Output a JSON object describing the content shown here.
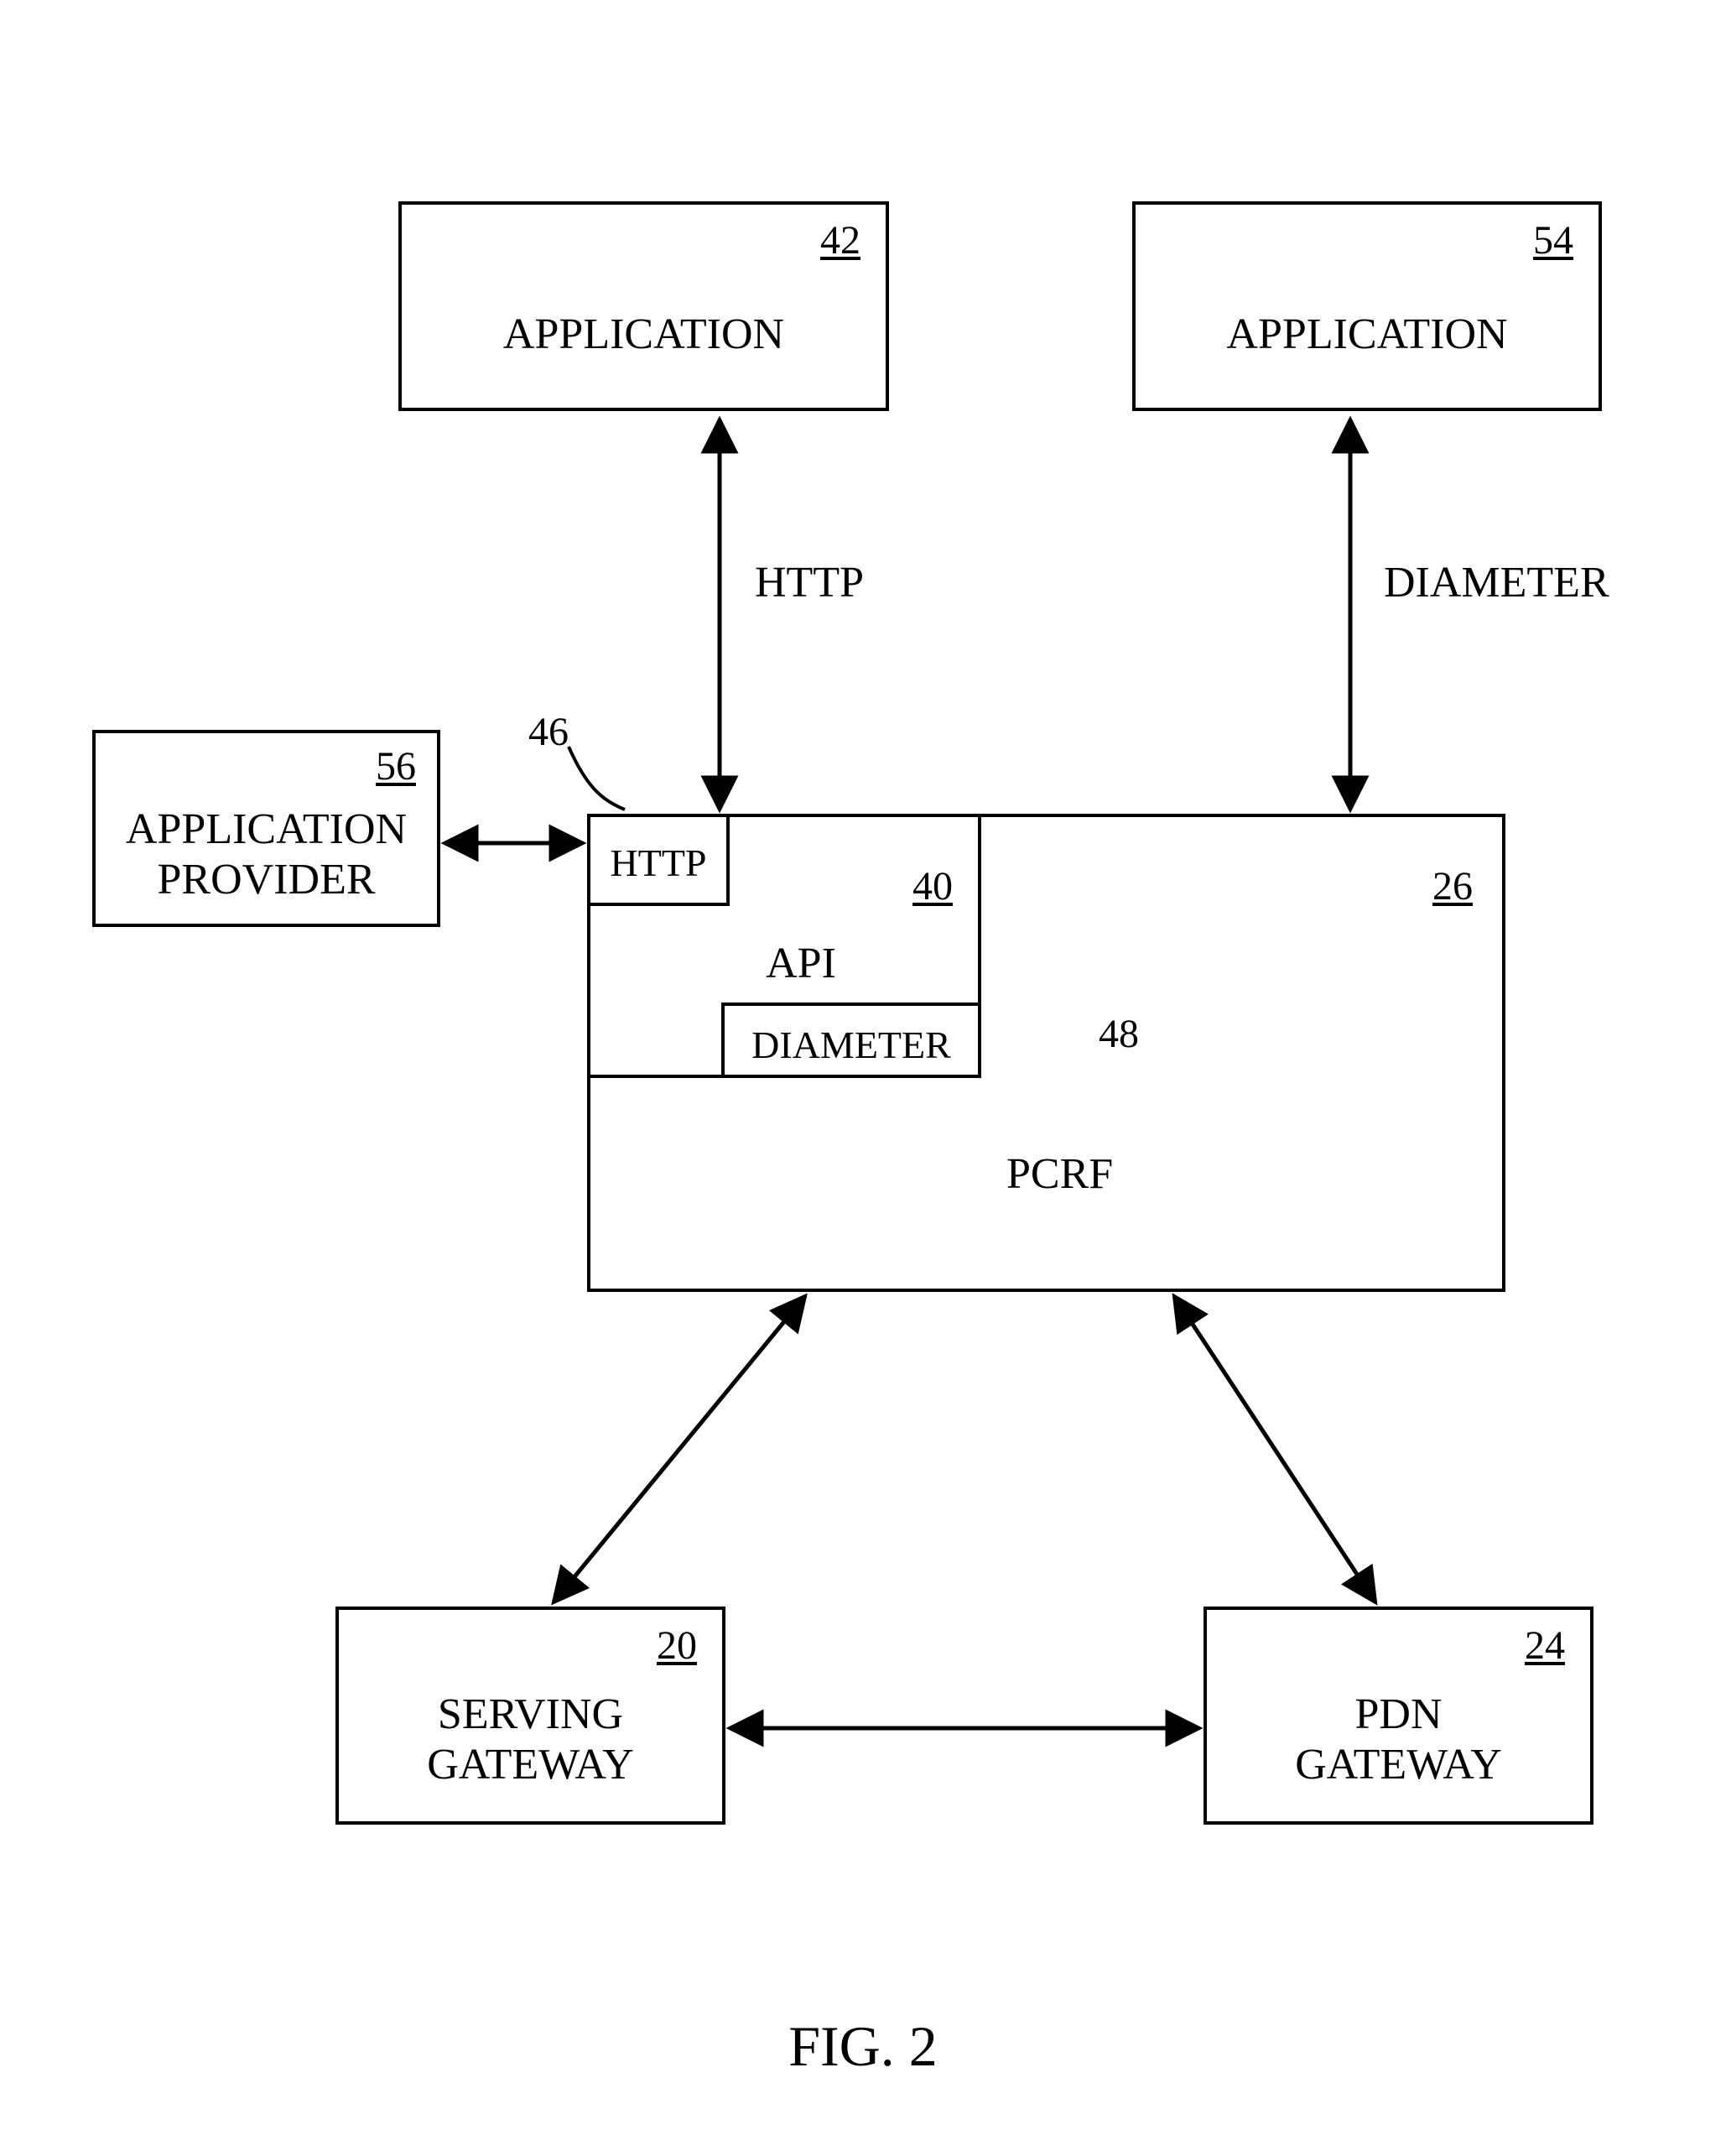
{
  "figure_caption": "FIG. 2",
  "boxes": {
    "app42": {
      "ref": "42",
      "label": "APPLICATION"
    },
    "app54": {
      "ref": "54",
      "label": "APPLICATION"
    },
    "provider56": {
      "ref": "56",
      "label": "APPLICATION\nPROVIDER"
    },
    "pcrf26": {
      "ref": "26"
    },
    "api40": {
      "ref": "40",
      "label": "API"
    },
    "http_block": {
      "label": "HTTP"
    },
    "diameter_block": {
      "label": "DIAMETER"
    },
    "sgw20": {
      "ref": "20",
      "label": "SERVING\nGATEWAY"
    },
    "pgw24": {
      "ref": "24",
      "label": "PDN\nGATEWAY"
    }
  },
  "edge_labels": {
    "http": "HTTP",
    "diameter": "DIAMETER",
    "pcrf": "PCRF"
  },
  "leaders": {
    "l46": "46",
    "l48": "48"
  }
}
